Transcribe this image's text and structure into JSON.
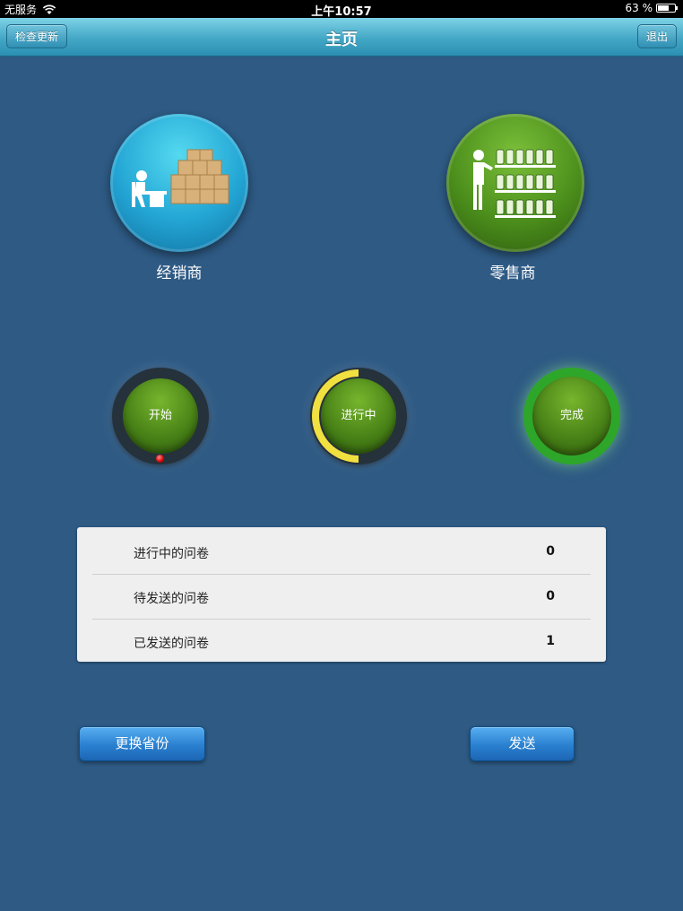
{
  "status_bar": {
    "carrier": "无服务",
    "time": "上午10:57",
    "battery": "63 %",
    "battery_level": 0.63
  },
  "nav": {
    "title": "主页",
    "left_button": "检查更新",
    "right_button": "退出"
  },
  "categories": {
    "distributor": {
      "label": "经销商",
      "icon": "distributor-warehouse-icon"
    },
    "retailer": {
      "label": "零售商",
      "icon": "retailer-shelf-icon"
    }
  },
  "status_dials": [
    {
      "label": "开始"
    },
    {
      "label": "进行中"
    },
    {
      "label": "完成"
    }
  ],
  "summary": {
    "rows": [
      {
        "label": "进行中的问卷",
        "value": "0"
      },
      {
        "label": "待发送的问卷",
        "value": "0"
      },
      {
        "label": "已发送的问卷",
        "value": "1"
      }
    ]
  },
  "actions": {
    "change_province": "更换省份",
    "send": "发送"
  },
  "colors": {
    "background": "#2e5a84",
    "nav_bar": "#43a7c6",
    "distributor": "#23a5d4",
    "retailer": "#4c8f1c",
    "button": "#2a80d0",
    "progress_ring": "#f0e040",
    "complete_ring": "#2da62a"
  }
}
